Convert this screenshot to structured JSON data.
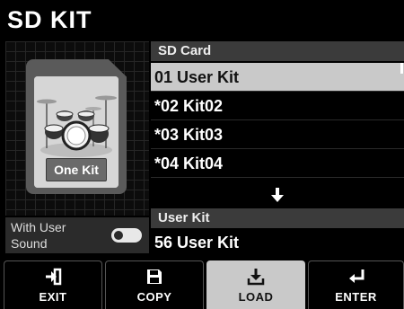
{
  "header": {
    "title": "SD KIT"
  },
  "preview": {
    "badge_label": "One Kit"
  },
  "with_user_sound": {
    "label_line1": "With User",
    "label_line2": "Sound",
    "enabled": false
  },
  "sd_card": {
    "header": "SD Card",
    "kits": [
      {
        "label": "01 User Kit",
        "selected": true
      },
      {
        "label": "*02 Kit02",
        "selected": false
      },
      {
        "label": "*03 Kit03",
        "selected": false
      },
      {
        "label": "*04 Kit04",
        "selected": false
      }
    ]
  },
  "user_kit": {
    "header": "User Kit",
    "value": "56 User Kit"
  },
  "buttons": [
    {
      "label": "EXIT",
      "icon": "exit-icon",
      "active": false
    },
    {
      "label": "COPY",
      "icon": "save-icon",
      "active": false
    },
    {
      "label": "LOAD",
      "icon": "download-icon",
      "active": true
    },
    {
      "label": "ENTER",
      "icon": "enter-icon",
      "active": false
    }
  ],
  "colors": {
    "selected_row": "#c9c9c9",
    "section_header": "#3b3b3b"
  }
}
